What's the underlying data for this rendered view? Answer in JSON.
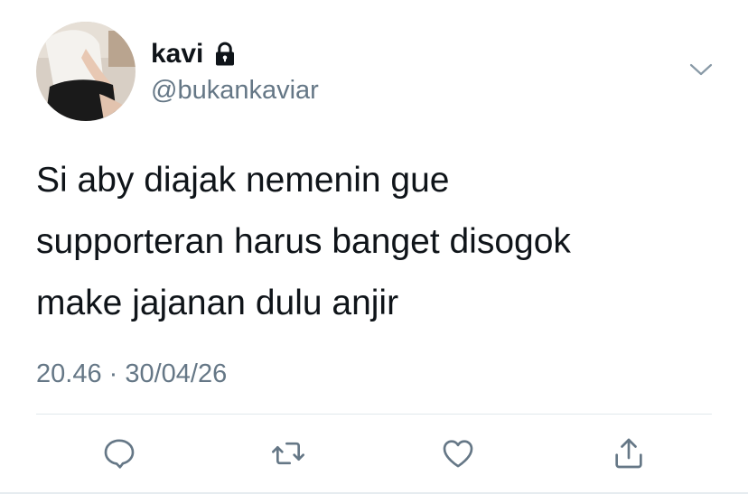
{
  "user": {
    "display_name": "kavi",
    "handle": "@bukankaviar",
    "protected_icon": "lock-icon"
  },
  "tweet": {
    "lines": [
      "Si aby diajak nemenin gue",
      "supporteran harus banget disogok",
      "make jajanan dulu anjir"
    ],
    "timestamp": "20.46 · 30/04/26"
  },
  "actions": {
    "reply_icon": "reply-icon",
    "retweet_icon": "retweet-icon",
    "like_icon": "like-icon",
    "share_icon": "share-icon"
  },
  "colors": {
    "text_primary": "#0f1419",
    "text_secondary": "#657786",
    "icon": "#657786",
    "divider": "#e1e8ed"
  }
}
